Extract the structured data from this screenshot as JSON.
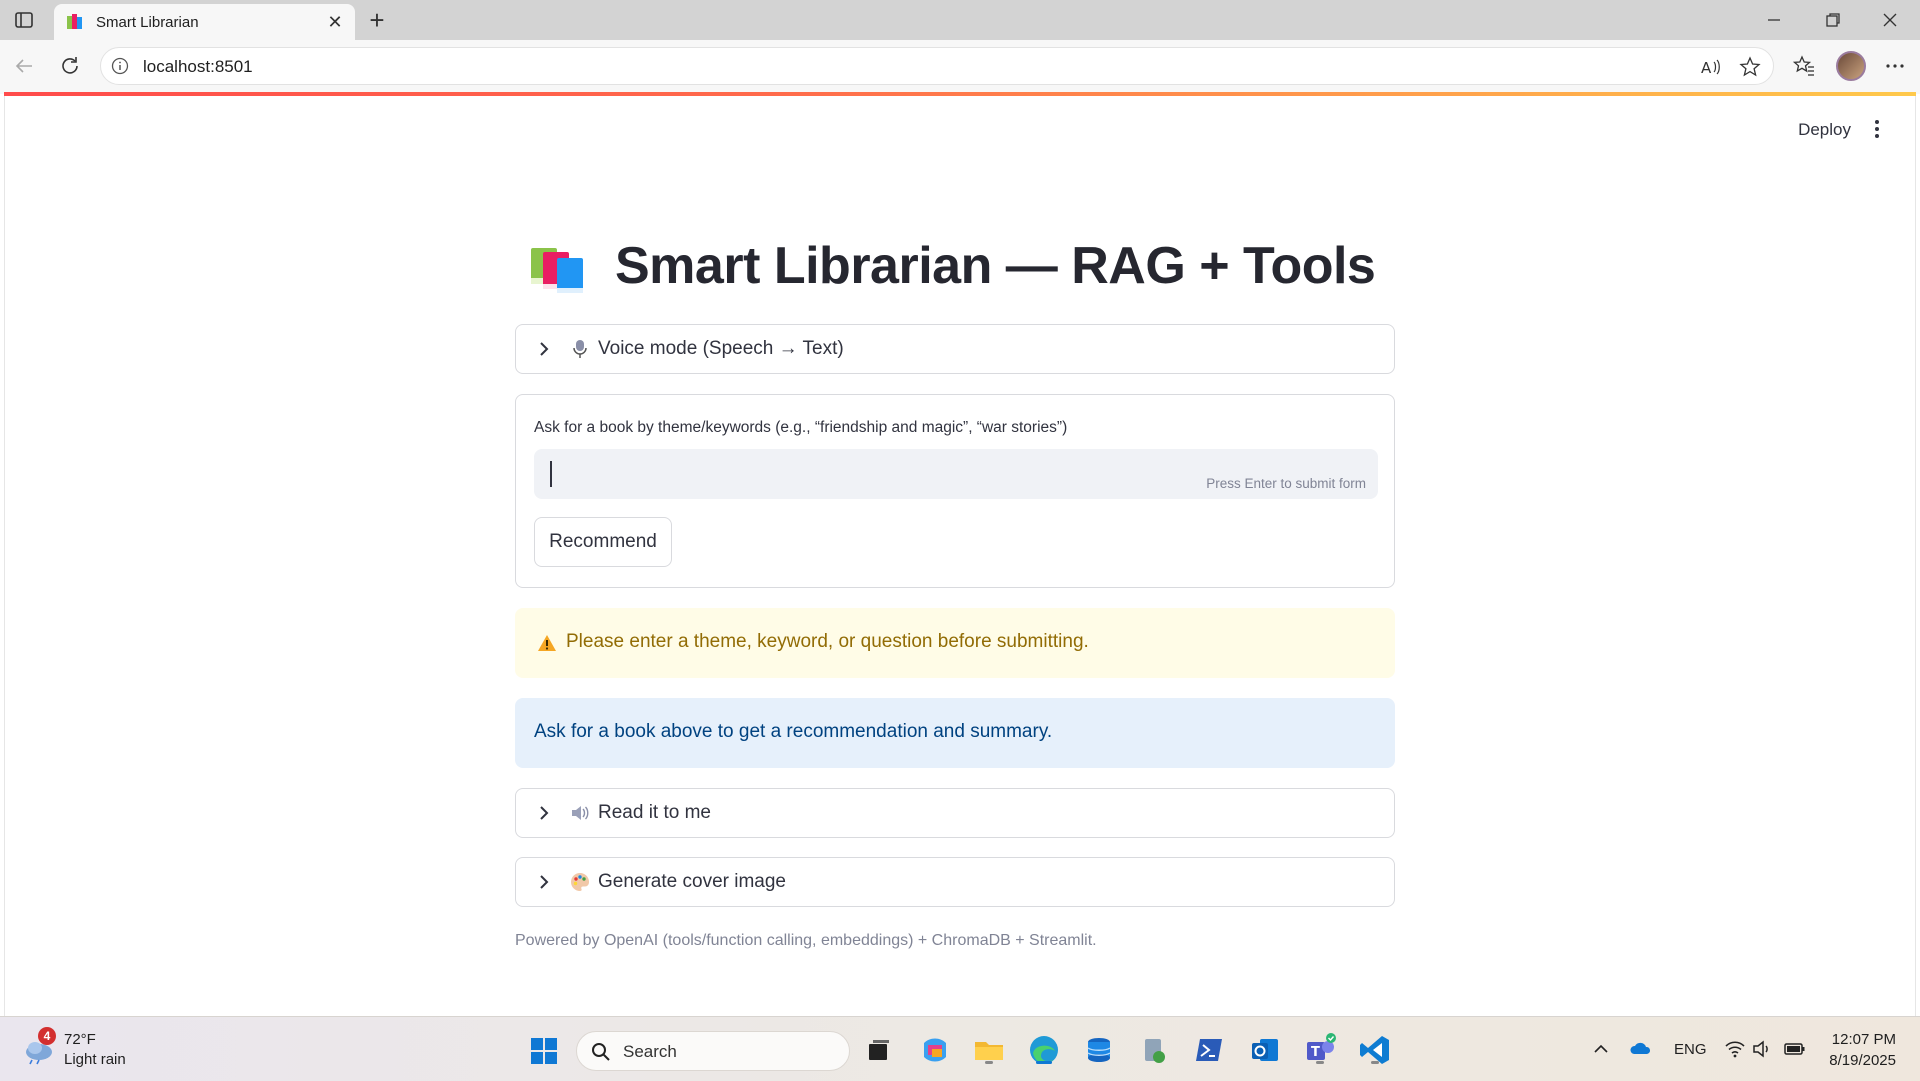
{
  "browser": {
    "tab_title": "Smart Librarian",
    "url": "localhost:8501"
  },
  "app": {
    "deploy_label": "Deploy",
    "title": "Smart Librarian — RAG + Tools",
    "voice_expander": "Voice mode (Speech → Text)",
    "form": {
      "label": "Ask for a book by theme/keywords (e.g., “friendship and magic”, “war stories”)",
      "input_value": "",
      "hint": "Press Enter to submit form",
      "submit_label": "Recommend"
    },
    "warning": "Please enter a theme, keyword, or question before submitting.",
    "info": "Ask for a book above to get a recommendation and summary.",
    "read_expander": "Read it to me",
    "cover_expander": "Generate cover image",
    "footer": "Powered by OpenAI (tools/function calling, embeddings) + ChromaDB + Streamlit."
  },
  "taskbar": {
    "weather_badge": "4",
    "weather_temp": "72°F",
    "weather_condition": "Light rain",
    "search_placeholder": "Search",
    "language": "ENG",
    "time": "12:07 PM",
    "date": "8/19/2025"
  },
  "colors": {
    "warning_bg": "#fffce7",
    "warning_text": "#926c05",
    "info_bg": "#e6f0fb",
    "info_text": "#004280",
    "accent_line": "#ff4b4b"
  }
}
